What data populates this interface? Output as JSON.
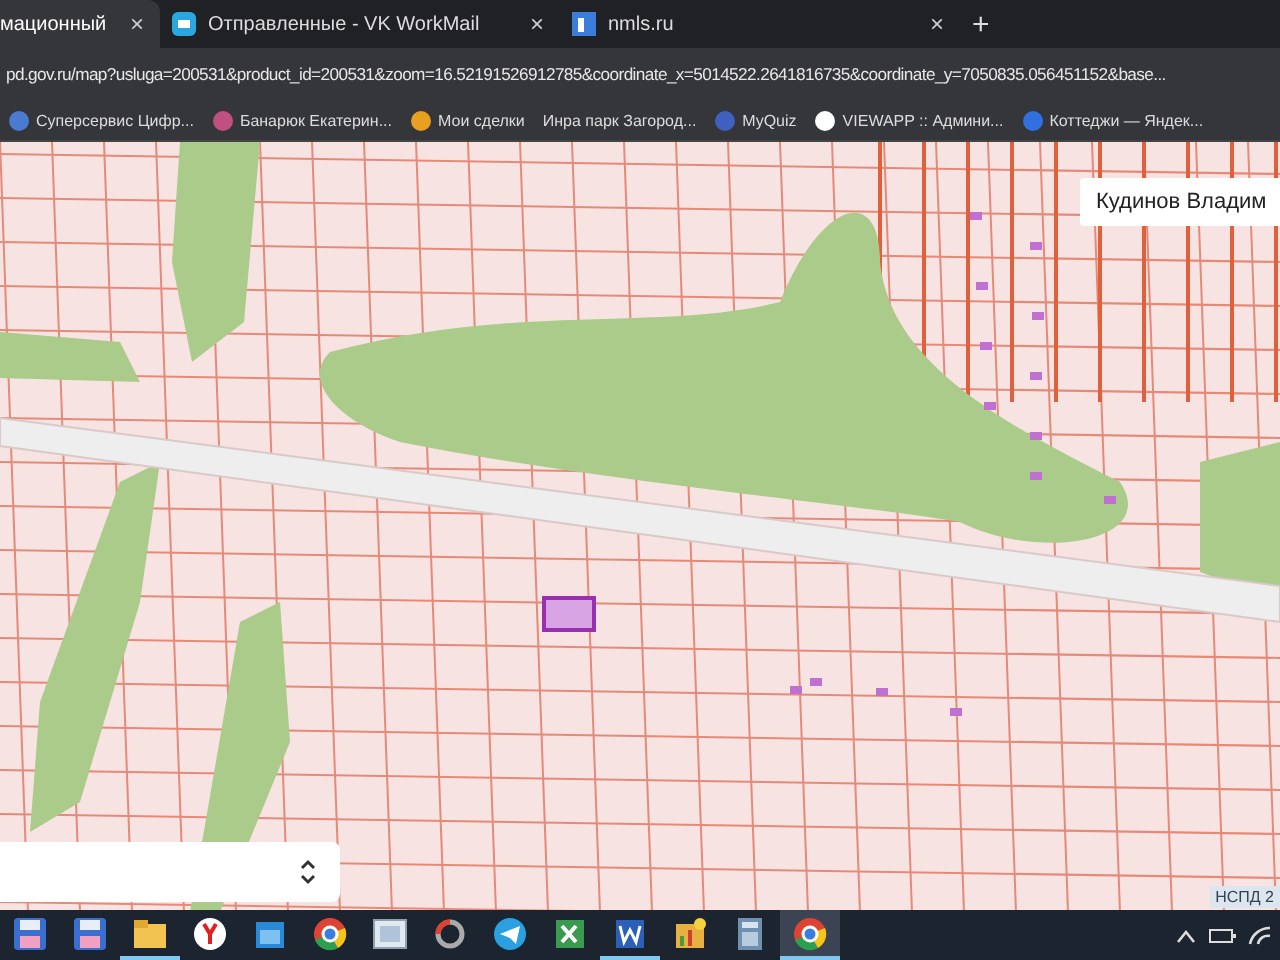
{
  "tabs": [
    {
      "label": "мационный",
      "selected": true,
      "close": "×"
    },
    {
      "label": "Отправленные - VK WorkMail",
      "selected": false,
      "close": "×"
    },
    {
      "label": "nmls.ru",
      "selected": false,
      "close": "×"
    }
  ],
  "new_tab": "+",
  "address_bar": {
    "url": "pd.gov.ru/map?usluga=200531&product_id=200531&zoom=16.52191526912785&coordinate_x=5014522.2641816735&coordinate_y=7050835.056451152&base..."
  },
  "bookmarks": [
    {
      "label": "Суперсервис Цифр..."
    },
    {
      "label": "Банарюк Екатерин..."
    },
    {
      "label": "Мои сделки"
    },
    {
      "label": "Инра парк Загород..."
    },
    {
      "label": "MyQuiz"
    },
    {
      "label": "VIEWAPP :: Админи..."
    },
    {
      "label": "Коттеджи — Яндек..."
    }
  ],
  "map": {
    "tooltip": "Кудинов Владим",
    "attribution": "НСПД 2"
  },
  "taskbar": {
    "apps": [
      {
        "kind": "disk",
        "running": false
      },
      {
        "kind": "disk",
        "running": false
      },
      {
        "kind": "folder",
        "running": true
      },
      {
        "kind": "ybrowser",
        "running": false
      },
      {
        "kind": "calendar",
        "running": false
      },
      {
        "kind": "chrome",
        "running": false
      },
      {
        "kind": "window",
        "running": false
      },
      {
        "kind": "ring",
        "running": false
      },
      {
        "kind": "plane",
        "running": false
      },
      {
        "kind": "sheet",
        "running": false
      },
      {
        "kind": "doc",
        "running": true
      },
      {
        "kind": "chart",
        "running": false
      },
      {
        "kind": "calc",
        "running": false
      },
      {
        "kind": "chrome",
        "running": true,
        "selected": true
      }
    ]
  }
}
